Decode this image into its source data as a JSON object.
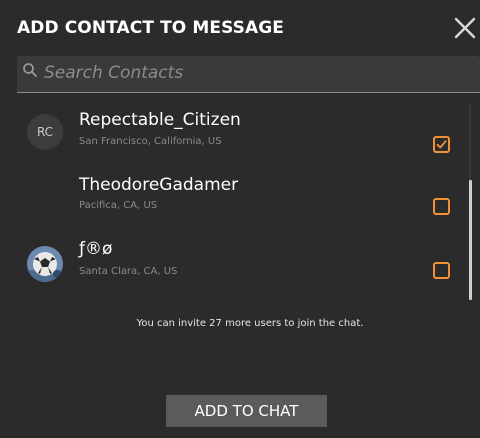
{
  "header": {
    "title": "ADD CONTACT TO MESSAGE",
    "close_icon": "close-icon"
  },
  "search": {
    "icon": "search-icon",
    "placeholder": "Search Contacts",
    "value": ""
  },
  "contacts": [
    {
      "initials": "RC",
      "name": "Repectable_Citizen",
      "location": "San Francisco, California, US",
      "checked": true
    },
    {
      "initials": "",
      "name": "TheodoreGadamer",
      "location": "Pacifica, CA, US",
      "checked": false
    },
    {
      "initials": "",
      "avatar": "soccer-ball-photo",
      "name": "ƒ®ø",
      "location": "Santa Clara, CA, US",
      "checked": false
    }
  ],
  "invite_text": "You can invite 27 more users to join the chat.",
  "footer": {
    "add_label": "ADD TO CHAT"
  },
  "colors": {
    "background": "#2b2b2b",
    "accent": "#f0913a",
    "button": "#5b5b5b",
    "muted_text": "#8a8a8a"
  }
}
